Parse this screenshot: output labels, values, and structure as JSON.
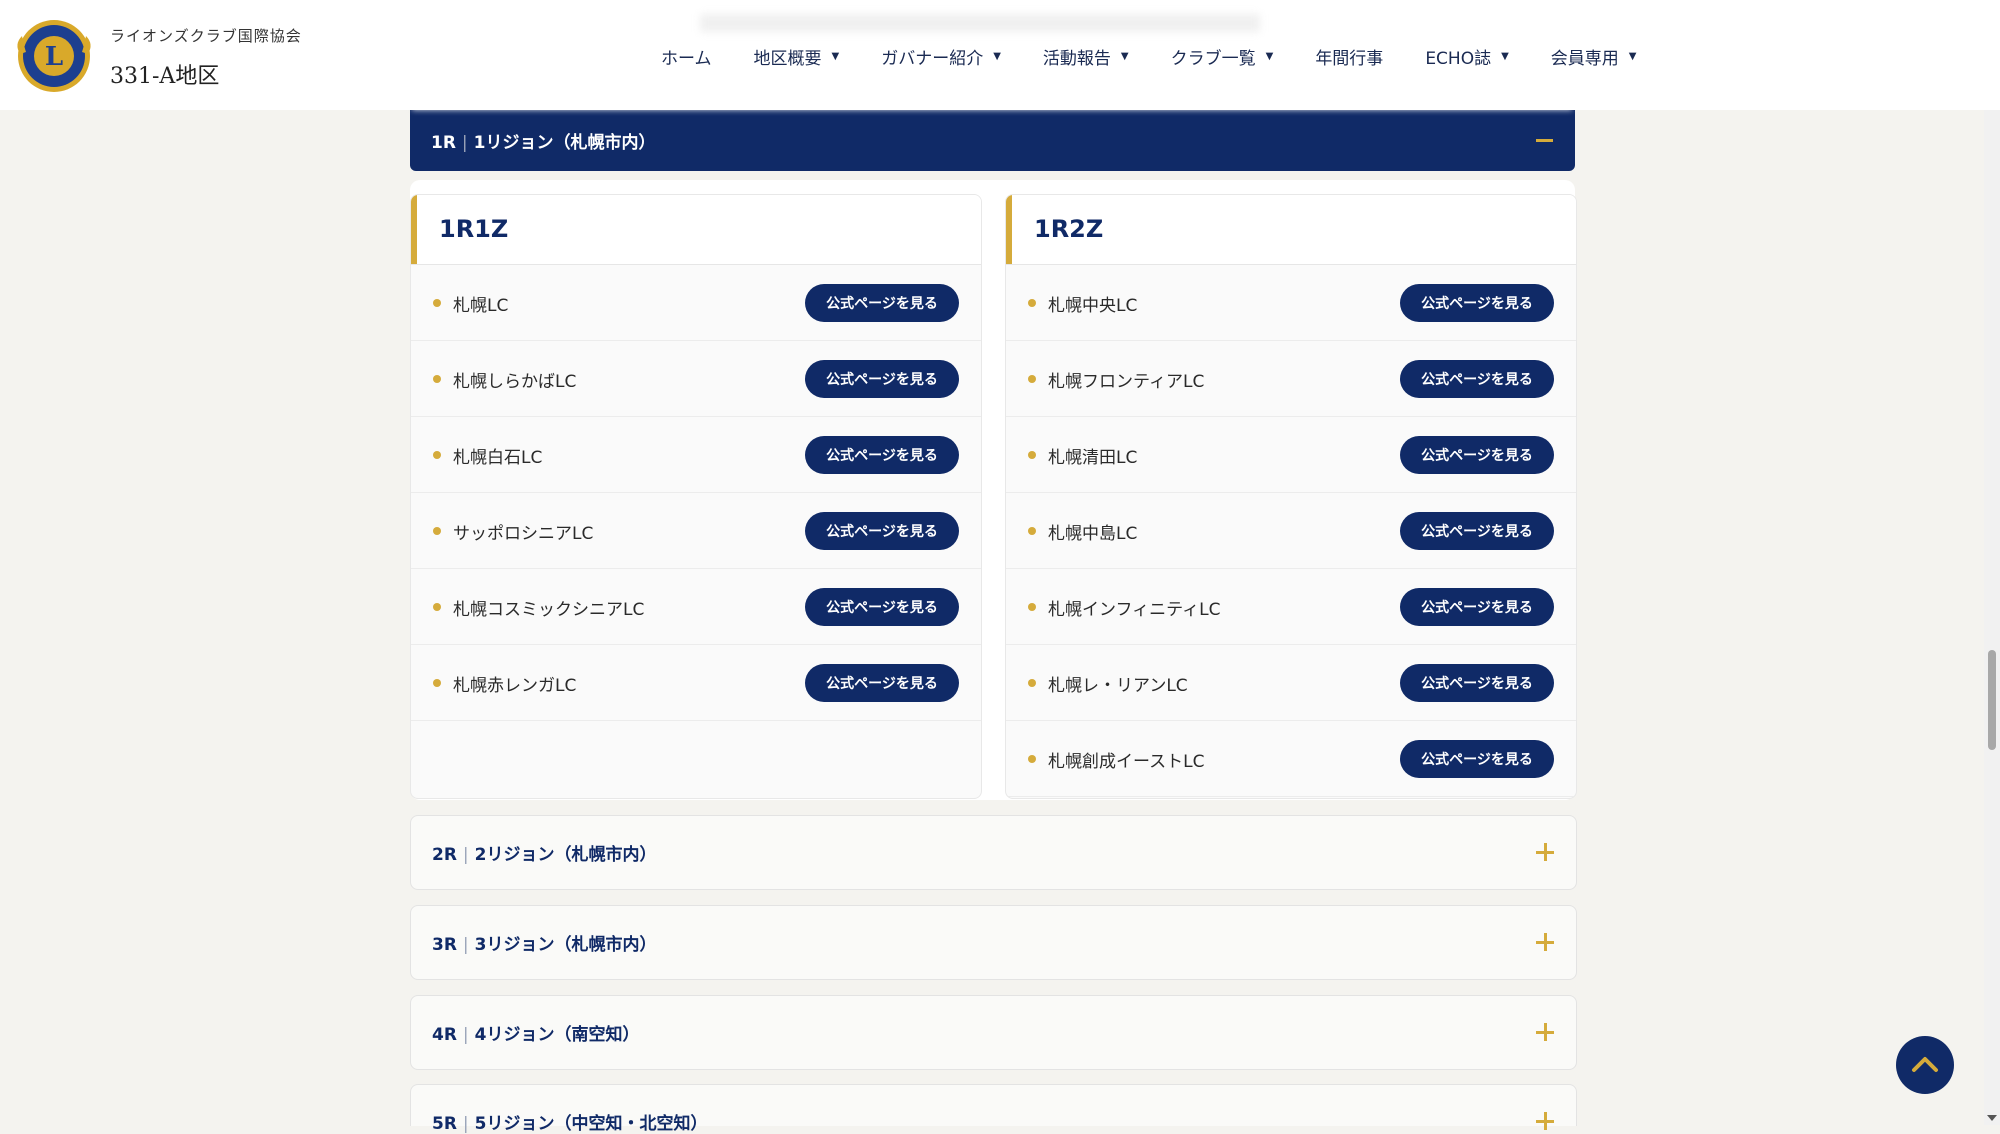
{
  "header": {
    "org_subtitle": "ライオンズクラブ国際協会",
    "org_title": "331-A地区",
    "nav": [
      {
        "label": "ホーム",
        "has_dropdown": false
      },
      {
        "label": "地区概要",
        "has_dropdown": true
      },
      {
        "label": "ガバナー紹介",
        "has_dropdown": true
      },
      {
        "label": "活動報告",
        "has_dropdown": true
      },
      {
        "label": "クラブ一覧",
        "has_dropdown": true
      },
      {
        "label": "年間行事",
        "has_dropdown": false
      },
      {
        "label": "ECHO誌",
        "has_dropdown": true
      },
      {
        "label": "会員専用",
        "has_dropdown": true
      }
    ]
  },
  "open_region": {
    "code": "1R",
    "name": "1リジョン（札幌市内）",
    "zones": [
      {
        "title": "1R1Z",
        "clubs": [
          "札幌LC",
          "札幌しらかばLC",
          "札幌白石LC",
          "サッポロシニアLC",
          "札幌コスミックシニアLC",
          "札幌赤レンガLC"
        ]
      },
      {
        "title": "1R2Z",
        "clubs": [
          "札幌中央LC",
          "札幌フロンティアLC",
          "札幌清田LC",
          "札幌中島LC",
          "札幌インフィニティLC",
          "札幌レ・リアンLC",
          "札幌創成イーストLC"
        ]
      }
    ],
    "button_label": "公式ページを見る"
  },
  "closed_regions": [
    {
      "code": "2R",
      "name": "2リジョン（札幌市内）"
    },
    {
      "code": "3R",
      "name": "3リジョン（札幌市内）"
    },
    {
      "code": "4R",
      "name": "4リジョン（南空知）"
    },
    {
      "code": "5R",
      "name": "5リジョン（中空知・北空知）"
    }
  ],
  "colors": {
    "navy": "#102a67",
    "gold": "#d5ab3b",
    "background": "#f4f3ef"
  }
}
